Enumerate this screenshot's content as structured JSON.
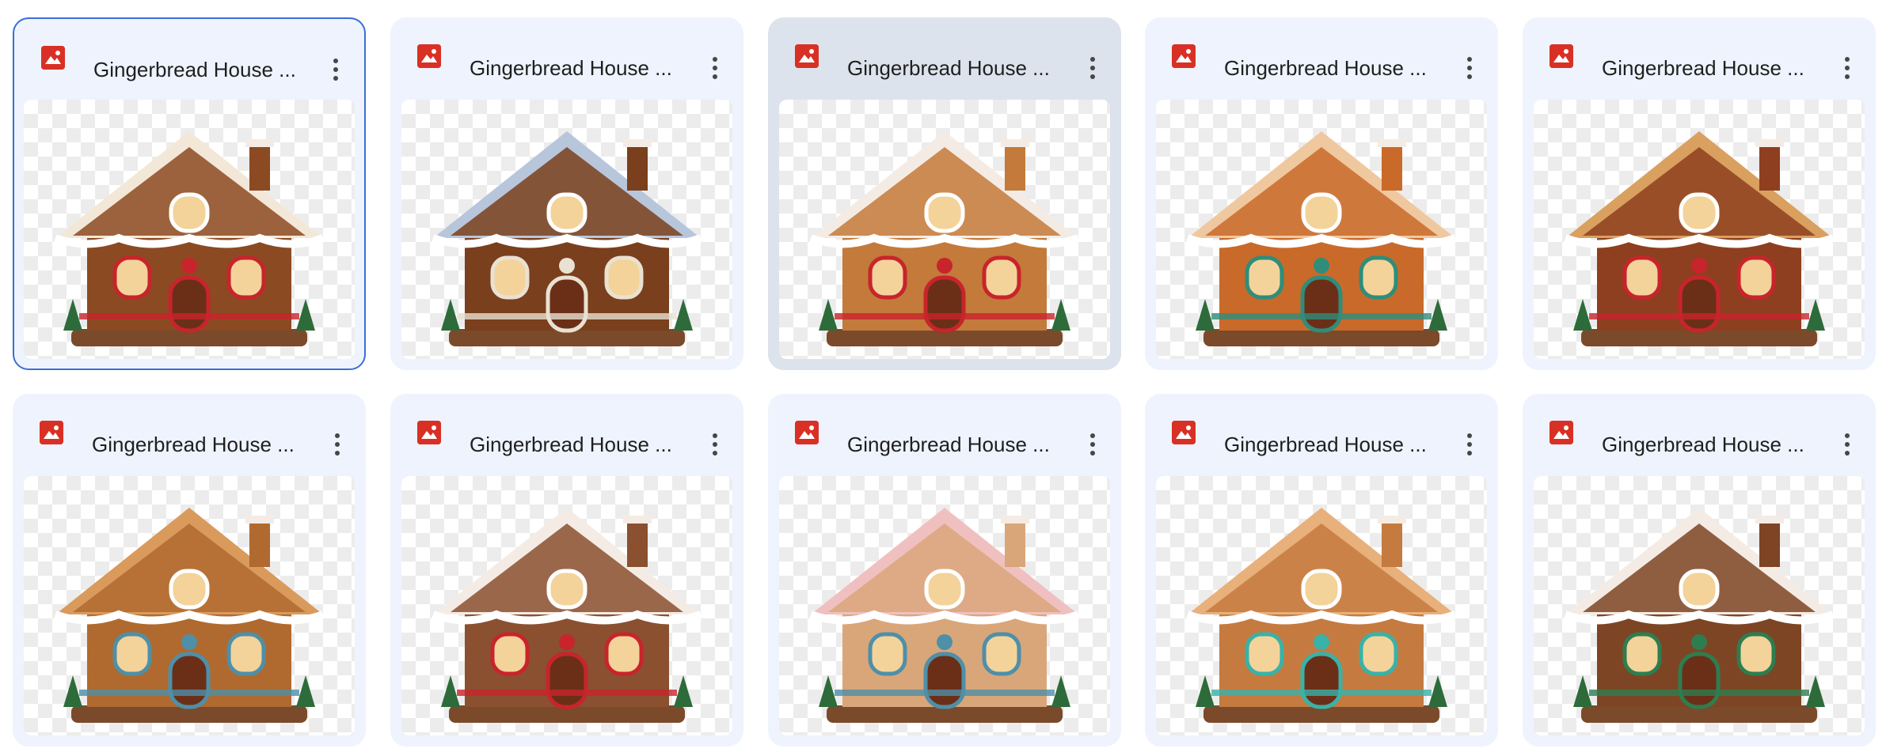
{
  "files": [
    {
      "name": "Gingerbread House ...",
      "state": "selected",
      "accent": "#8b4a22",
      "roof": "#f3e7d8",
      "trim": "#c8242c"
    },
    {
      "name": "Gingerbread House ...",
      "state": "normal",
      "accent": "#7a3f1c",
      "roof": "#b8c6dc",
      "trim": "#e9e1d2"
    },
    {
      "name": "Gingerbread House ...",
      "state": "hovered",
      "accent": "#c37a3a",
      "roof": "#f4ece4",
      "trim": "#c8242c"
    },
    {
      "name": "Gingerbread House ...",
      "state": "normal",
      "accent": "#c96a2a",
      "roof": "#f0c8a0",
      "trim": "#2f8d7a"
    },
    {
      "name": "Gingerbread House ...",
      "state": "normal",
      "accent": "#8e3f1f",
      "roof": "#d9a060",
      "trim": "#c8242c"
    },
    {
      "name": "Gingerbread House ...",
      "state": "normal",
      "accent": "#b06a2f",
      "roof": "#d99a5c",
      "trim": "#4f8fa8"
    },
    {
      "name": "Gingerbread House ...",
      "state": "normal",
      "accent": "#8a5030",
      "roof": "#f4ece4",
      "trim": "#c8242c"
    },
    {
      "name": "Gingerbread House ...",
      "state": "normal",
      "accent": "#d9a67a",
      "roof": "#f0c0c0",
      "trim": "#4f8fa8"
    },
    {
      "name": "Gingerbread House ...",
      "state": "normal",
      "accent": "#c57a40",
      "roof": "#e8b07a",
      "trim": "#39b2a8"
    },
    {
      "name": "Gingerbread House ...",
      "state": "normal",
      "accent": "#7d4524",
      "roof": "#f4ece4",
      "trim": "#2e7d4f"
    }
  ],
  "icons": {
    "file_type": "image-file-icon",
    "menu": "more-vertical-icon"
  },
  "colors": {
    "card_bg": "#eef3fd",
    "hover_bg": "#dde3ec",
    "selected_border": "#3b6fd4",
    "icon_red": "#d93025"
  }
}
